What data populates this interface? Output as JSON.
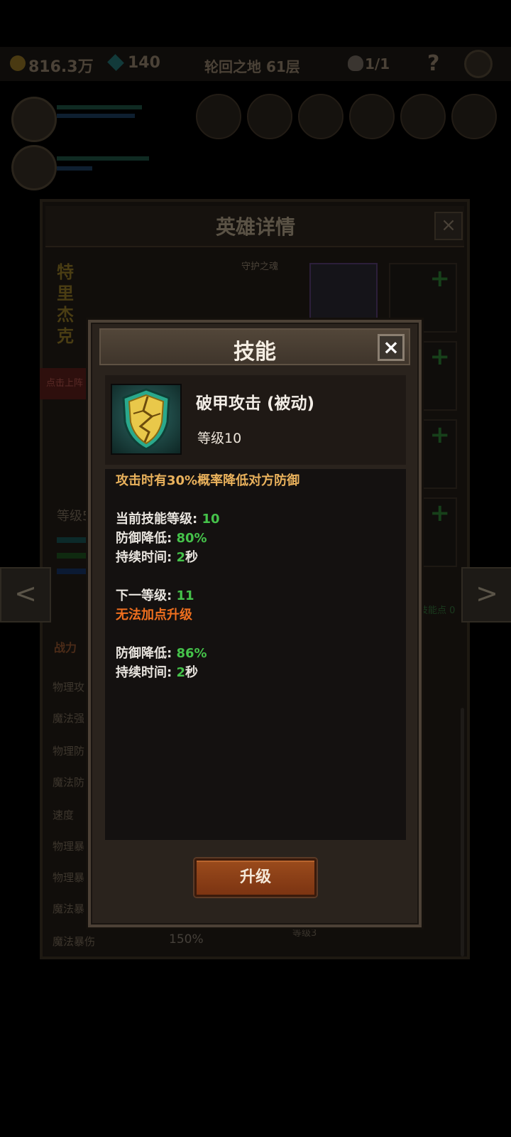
{
  "topbar": {
    "gold": "816.3万",
    "gems": "140",
    "stage": "轮回之地 61层",
    "lives": "1/1",
    "help": "?"
  },
  "hero_detail": {
    "title": "英雄详情",
    "close": "×",
    "hero_name": "特里杰克",
    "guard_label": "守护之魂",
    "deploy_button": "点击上阵",
    "level_label": "等级5",
    "skill_points": "技能点 0",
    "stats_header": "战力",
    "stat_labels": [
      "物理攻",
      "魔法强",
      "物理防",
      "魔法防",
      "速度",
      "物理暴",
      "物理暴",
      "魔法暴",
      "魔法暴伤"
    ],
    "magic_crit_damage": "150%",
    "slot_level": "等级3",
    "prev_arrow": "<",
    "next_arrow": ">"
  },
  "skill_dialog": {
    "title": "技能",
    "close": "×",
    "icon": "cracked-shield-icon",
    "skill_name": "破甲攻击 (被动)",
    "skill_level": "等级10",
    "description": "攻击时有30%概率降低对方防御",
    "current_level_label": "当前技能等级: ",
    "current_level_value": "10",
    "armor_reduce_label": "防御降低: ",
    "armor_reduce_value": "80%",
    "duration_label": "持续时间: ",
    "duration_value": "2",
    "duration_unit": "秒",
    "next_level_label": "下一等级: ",
    "next_level_value": "11",
    "cannot_upgrade": "无法加点升级",
    "next_armor_reduce_label": "防御降低: ",
    "next_armor_reduce_value": "86%",
    "next_duration_label": "持续时间: ",
    "next_duration_value": "2",
    "next_duration_unit": "秒",
    "upgrade_button": "升级"
  }
}
